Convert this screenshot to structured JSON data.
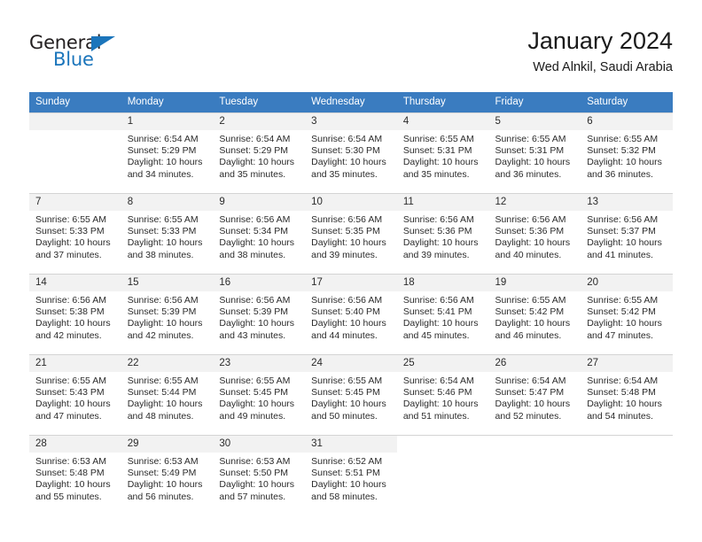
{
  "brand": {
    "name_top": "General",
    "name_bottom": "Blue",
    "accent_color": "#1b75bb"
  },
  "header": {
    "month_title": "January 2024",
    "location": "Wed Alnkil, Saudi Arabia"
  },
  "theme": {
    "header_row_bg": "#3a7cc0",
    "daynum_bg": "#f2f2f2",
    "grid_line": "#d4d4d4",
    "text": "#2b2b2b"
  },
  "weekday_headers": [
    "Sunday",
    "Monday",
    "Tuesday",
    "Wednesday",
    "Thursday",
    "Friday",
    "Saturday"
  ],
  "weeks": [
    [
      {
        "day": "",
        "sunrise": "",
        "sunset": "",
        "daylight_1": "",
        "daylight_2": "",
        "empty": true
      },
      {
        "day": "1",
        "sunrise": "Sunrise: 6:54 AM",
        "sunset": "Sunset: 5:29 PM",
        "daylight_1": "Daylight: 10 hours",
        "daylight_2": "and 34 minutes."
      },
      {
        "day": "2",
        "sunrise": "Sunrise: 6:54 AM",
        "sunset": "Sunset: 5:29 PM",
        "daylight_1": "Daylight: 10 hours",
        "daylight_2": "and 35 minutes."
      },
      {
        "day": "3",
        "sunrise": "Sunrise: 6:54 AM",
        "sunset": "Sunset: 5:30 PM",
        "daylight_1": "Daylight: 10 hours",
        "daylight_2": "and 35 minutes."
      },
      {
        "day": "4",
        "sunrise": "Sunrise: 6:55 AM",
        "sunset": "Sunset: 5:31 PM",
        "daylight_1": "Daylight: 10 hours",
        "daylight_2": "and 35 minutes."
      },
      {
        "day": "5",
        "sunrise": "Sunrise: 6:55 AM",
        "sunset": "Sunset: 5:31 PM",
        "daylight_1": "Daylight: 10 hours",
        "daylight_2": "and 36 minutes."
      },
      {
        "day": "6",
        "sunrise": "Sunrise: 6:55 AM",
        "sunset": "Sunset: 5:32 PM",
        "daylight_1": "Daylight: 10 hours",
        "daylight_2": "and 36 minutes."
      }
    ],
    [
      {
        "day": "7",
        "sunrise": "Sunrise: 6:55 AM",
        "sunset": "Sunset: 5:33 PM",
        "daylight_1": "Daylight: 10 hours",
        "daylight_2": "and 37 minutes."
      },
      {
        "day": "8",
        "sunrise": "Sunrise: 6:55 AM",
        "sunset": "Sunset: 5:33 PM",
        "daylight_1": "Daylight: 10 hours",
        "daylight_2": "and 38 minutes."
      },
      {
        "day": "9",
        "sunrise": "Sunrise: 6:56 AM",
        "sunset": "Sunset: 5:34 PM",
        "daylight_1": "Daylight: 10 hours",
        "daylight_2": "and 38 minutes."
      },
      {
        "day": "10",
        "sunrise": "Sunrise: 6:56 AM",
        "sunset": "Sunset: 5:35 PM",
        "daylight_1": "Daylight: 10 hours",
        "daylight_2": "and 39 minutes."
      },
      {
        "day": "11",
        "sunrise": "Sunrise: 6:56 AM",
        "sunset": "Sunset: 5:36 PM",
        "daylight_1": "Daylight: 10 hours",
        "daylight_2": "and 39 minutes."
      },
      {
        "day": "12",
        "sunrise": "Sunrise: 6:56 AM",
        "sunset": "Sunset: 5:36 PM",
        "daylight_1": "Daylight: 10 hours",
        "daylight_2": "and 40 minutes."
      },
      {
        "day": "13",
        "sunrise": "Sunrise: 6:56 AM",
        "sunset": "Sunset: 5:37 PM",
        "daylight_1": "Daylight: 10 hours",
        "daylight_2": "and 41 minutes."
      }
    ],
    [
      {
        "day": "14",
        "sunrise": "Sunrise: 6:56 AM",
        "sunset": "Sunset: 5:38 PM",
        "daylight_1": "Daylight: 10 hours",
        "daylight_2": "and 42 minutes."
      },
      {
        "day": "15",
        "sunrise": "Sunrise: 6:56 AM",
        "sunset": "Sunset: 5:39 PM",
        "daylight_1": "Daylight: 10 hours",
        "daylight_2": "and 42 minutes."
      },
      {
        "day": "16",
        "sunrise": "Sunrise: 6:56 AM",
        "sunset": "Sunset: 5:39 PM",
        "daylight_1": "Daylight: 10 hours",
        "daylight_2": "and 43 minutes."
      },
      {
        "day": "17",
        "sunrise": "Sunrise: 6:56 AM",
        "sunset": "Sunset: 5:40 PM",
        "daylight_1": "Daylight: 10 hours",
        "daylight_2": "and 44 minutes."
      },
      {
        "day": "18",
        "sunrise": "Sunrise: 6:56 AM",
        "sunset": "Sunset: 5:41 PM",
        "daylight_1": "Daylight: 10 hours",
        "daylight_2": "and 45 minutes."
      },
      {
        "day": "19",
        "sunrise": "Sunrise: 6:55 AM",
        "sunset": "Sunset: 5:42 PM",
        "daylight_1": "Daylight: 10 hours",
        "daylight_2": "and 46 minutes."
      },
      {
        "day": "20",
        "sunrise": "Sunrise: 6:55 AM",
        "sunset": "Sunset: 5:42 PM",
        "daylight_1": "Daylight: 10 hours",
        "daylight_2": "and 47 minutes."
      }
    ],
    [
      {
        "day": "21",
        "sunrise": "Sunrise: 6:55 AM",
        "sunset": "Sunset: 5:43 PM",
        "daylight_1": "Daylight: 10 hours",
        "daylight_2": "and 47 minutes."
      },
      {
        "day": "22",
        "sunrise": "Sunrise: 6:55 AM",
        "sunset": "Sunset: 5:44 PM",
        "daylight_1": "Daylight: 10 hours",
        "daylight_2": "and 48 minutes."
      },
      {
        "day": "23",
        "sunrise": "Sunrise: 6:55 AM",
        "sunset": "Sunset: 5:45 PM",
        "daylight_1": "Daylight: 10 hours",
        "daylight_2": "and 49 minutes."
      },
      {
        "day": "24",
        "sunrise": "Sunrise: 6:55 AM",
        "sunset": "Sunset: 5:45 PM",
        "daylight_1": "Daylight: 10 hours",
        "daylight_2": "and 50 minutes."
      },
      {
        "day": "25",
        "sunrise": "Sunrise: 6:54 AM",
        "sunset": "Sunset: 5:46 PM",
        "daylight_1": "Daylight: 10 hours",
        "daylight_2": "and 51 minutes."
      },
      {
        "day": "26",
        "sunrise": "Sunrise: 6:54 AM",
        "sunset": "Sunset: 5:47 PM",
        "daylight_1": "Daylight: 10 hours",
        "daylight_2": "and 52 minutes."
      },
      {
        "day": "27",
        "sunrise": "Sunrise: 6:54 AM",
        "sunset": "Sunset: 5:48 PM",
        "daylight_1": "Daylight: 10 hours",
        "daylight_2": "and 54 minutes."
      }
    ],
    [
      {
        "day": "28",
        "sunrise": "Sunrise: 6:53 AM",
        "sunset": "Sunset: 5:48 PM",
        "daylight_1": "Daylight: 10 hours",
        "daylight_2": "and 55 minutes."
      },
      {
        "day": "29",
        "sunrise": "Sunrise: 6:53 AM",
        "sunset": "Sunset: 5:49 PM",
        "daylight_1": "Daylight: 10 hours",
        "daylight_2": "and 56 minutes."
      },
      {
        "day": "30",
        "sunrise": "Sunrise: 6:53 AM",
        "sunset": "Sunset: 5:50 PM",
        "daylight_1": "Daylight: 10 hours",
        "daylight_2": "and 57 minutes."
      },
      {
        "day": "31",
        "sunrise": "Sunrise: 6:52 AM",
        "sunset": "Sunset: 5:51 PM",
        "daylight_1": "Daylight: 10 hours",
        "daylight_2": "and 58 minutes."
      },
      {
        "day": "",
        "sunrise": "",
        "sunset": "",
        "daylight_1": "",
        "daylight_2": "",
        "blank": true
      },
      {
        "day": "",
        "sunrise": "",
        "sunset": "",
        "daylight_1": "",
        "daylight_2": "",
        "blank": true
      },
      {
        "day": "",
        "sunrise": "",
        "sunset": "",
        "daylight_1": "",
        "daylight_2": "",
        "blank": true
      }
    ]
  ]
}
